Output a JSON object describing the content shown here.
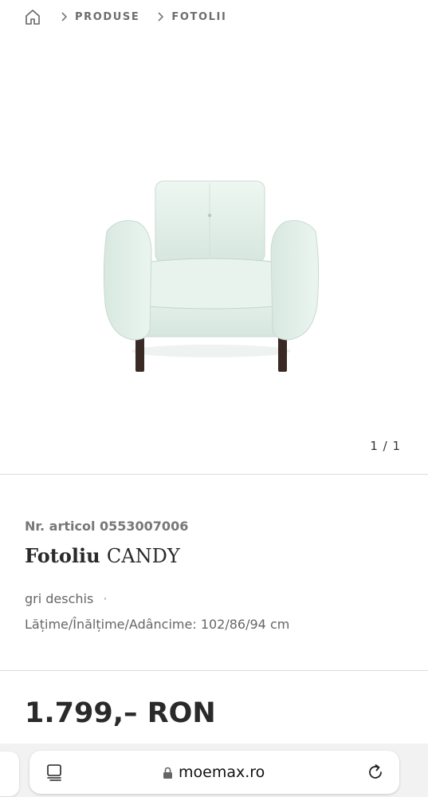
{
  "breadcrumb": {
    "home_icon": "home-icon",
    "separator_icon": "chevron-right-icon",
    "items": [
      "PRODUSE",
      "FOTOLII"
    ]
  },
  "gallery": {
    "counter": "1 / 1",
    "image_alt": "armchair-image"
  },
  "product": {
    "article_label": "Nr. articol 0553007006",
    "title_bold": "Fotoliu",
    "title_rest": "CANDY",
    "color": "gri deschis",
    "color_separator": "·",
    "dimensions": "Lățime/Înălțime/Adâncime: 102/86/94 cm"
  },
  "pricing": {
    "price": "1.799,– RON"
  },
  "browser": {
    "url": "moemax.ro",
    "tabs_icon": "tabs-icon",
    "lock_icon": "lock-icon",
    "reload_icon": "reload-icon"
  },
  "colors": {
    "text_dark": "#2a2a2a",
    "text_muted": "#777777",
    "divider": "#dcdcdc",
    "chair_fabric": "#e3f0ea"
  }
}
